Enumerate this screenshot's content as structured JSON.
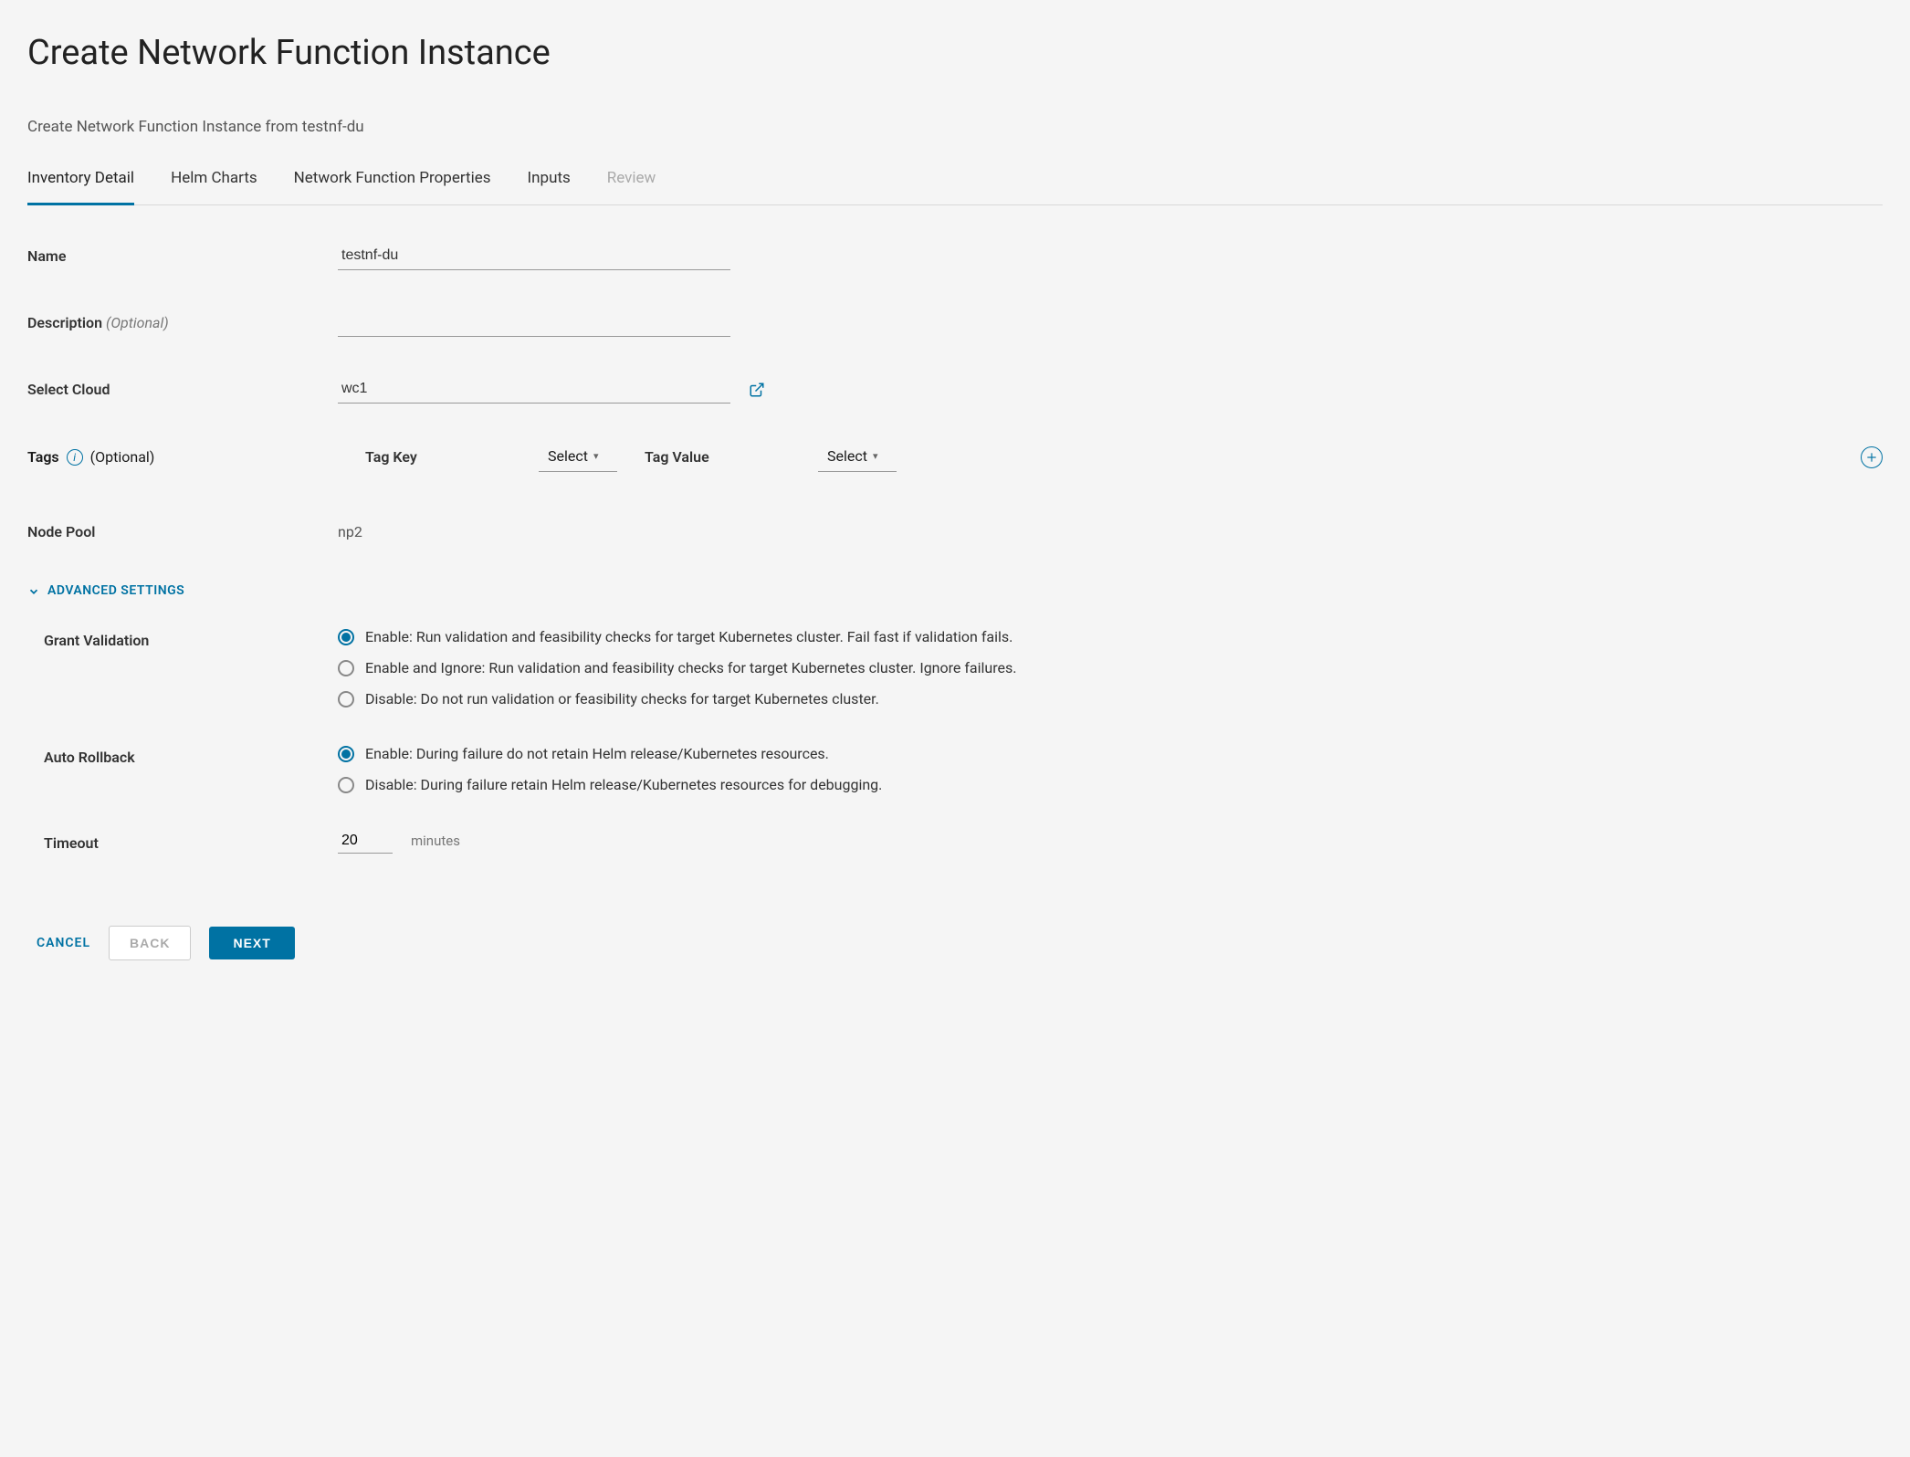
{
  "header": {
    "title": "Create Network Function Instance",
    "subtitle": "Create Network Function Instance from testnf-du"
  },
  "tabs": {
    "inventory": "Inventory Detail",
    "helm": "Helm Charts",
    "nfprops": "Network Function Properties",
    "inputs": "Inputs",
    "review": "Review"
  },
  "labels": {
    "name": "Name",
    "description": "Description",
    "optional": "(Optional)",
    "selectCloud": "Select Cloud",
    "tags": "Tags",
    "tagKey": "Tag Key",
    "tagValue": "Tag Value",
    "nodePool": "Node Pool",
    "advanced": "ADVANCED SETTINGS",
    "grantValidation": "Grant Validation",
    "autoRollback": "Auto Rollback",
    "timeout": "Timeout",
    "timeoutUnit": "minutes",
    "select": "Select"
  },
  "values": {
    "name": "testnf-du",
    "description": "",
    "cloud": "wc1",
    "nodePool": "np2",
    "timeout": "20"
  },
  "grantValidation": {
    "enable": "Enable: Run validation and feasibility checks for target Kubernetes cluster. Fail fast if validation fails.",
    "enableIgnore": "Enable and Ignore: Run validation and feasibility checks for target Kubernetes cluster. Ignore failures.",
    "disable": "Disable: Do not run validation or feasibility checks for target Kubernetes cluster."
  },
  "autoRollback": {
    "enable": "Enable: During failure do not retain Helm release/Kubernetes resources.",
    "disable": "Disable: During failure retain Helm release/Kubernetes resources for debugging."
  },
  "footer": {
    "cancel": "CANCEL",
    "back": "BACK",
    "next": "NEXT"
  }
}
